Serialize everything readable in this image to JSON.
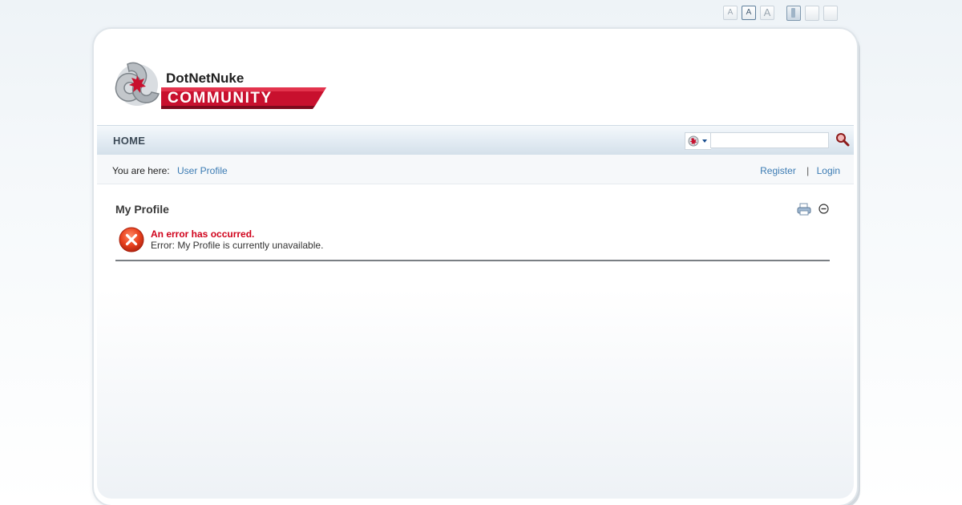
{
  "font_size_controls": [
    "A",
    "A",
    "A"
  ],
  "header": {
    "logo_top": "DotNetNuke",
    "logo_bottom": "COMMUNITY"
  },
  "nav": {
    "home_label": "HOME"
  },
  "search": {
    "placeholder": ""
  },
  "breadcrumb": {
    "label": "You are here:",
    "current": "User Profile"
  },
  "user_links": {
    "register": "Register",
    "separator": "|",
    "login": "Login"
  },
  "module": {
    "title": "My Profile",
    "error_title": "An error has occurred.",
    "error_message": "Error: My Profile is currently unavailable."
  },
  "colors": {
    "accent_red": "#c8102e",
    "link_blue": "#3b7bb3",
    "error_red": "#d0021b"
  }
}
